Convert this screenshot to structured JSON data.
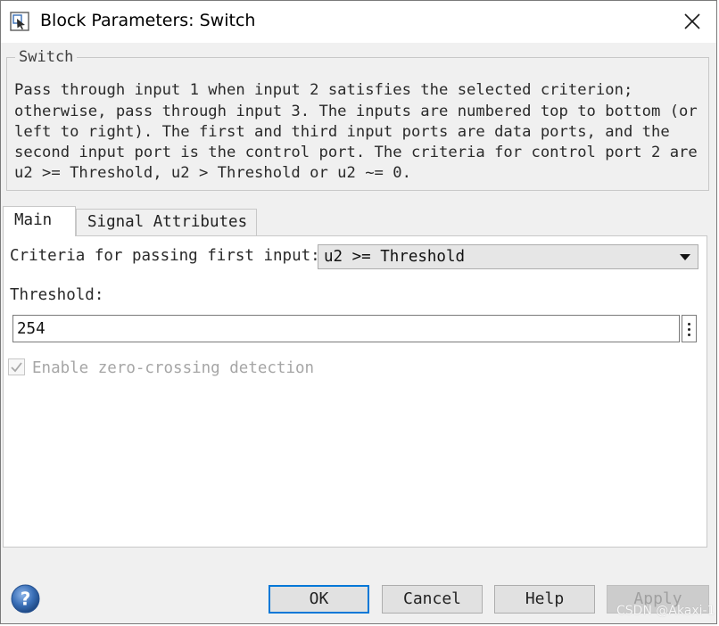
{
  "window": {
    "title": "Block Parameters: Switch",
    "close_glyph": "×"
  },
  "description": {
    "group_label": "Switch",
    "lines": [
      "Pass through input 1 when input 2 satisfies the selected criterion;",
      "otherwise, pass through input 3. The inputs are numbered top to bottom (or",
      "left to right). The first and third input ports are data ports, and the",
      "second input port is the control port. The criteria for control port 2 are",
      "u2 >= Threshold, u2 > Threshold or u2 ~= 0."
    ]
  },
  "tabs": [
    {
      "label": "Main",
      "selected": true
    },
    {
      "label": "Signal Attributes",
      "selected": false
    }
  ],
  "main": {
    "criteria_label": "Criteria for passing first input:",
    "criteria_value": "u2 >= Threshold",
    "threshold_label": "Threshold:",
    "threshold_value": "254",
    "zero_crossing_label": "Enable zero-crossing detection",
    "zero_crossing_checked": true,
    "zero_crossing_enabled": false
  },
  "buttons": {
    "ok": "OK",
    "cancel": "Cancel",
    "help": "Help",
    "apply": "Apply",
    "apply_enabled": false
  },
  "watermark": "CSDN @Akaxi-1",
  "colors": {
    "focus_border": "#0078d7",
    "help_icon": "#3a6fb7"
  }
}
